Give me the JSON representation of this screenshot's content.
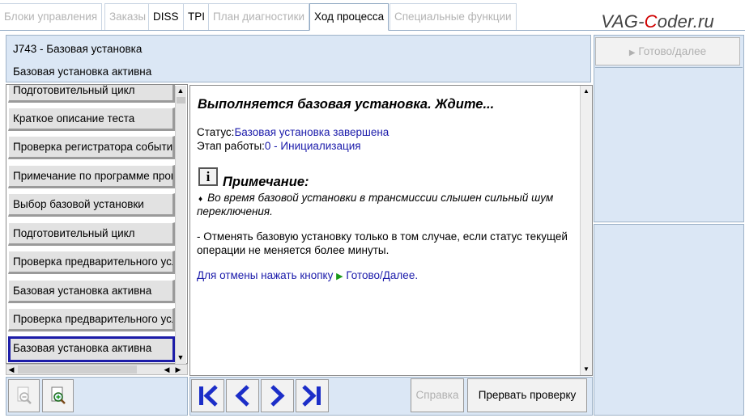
{
  "tabs": [
    {
      "label": "Блоки управления",
      "enabled": false
    },
    {
      "label": "Заказы",
      "enabled": false
    },
    {
      "label": "DISS",
      "enabled": true
    },
    {
      "label": "TPI",
      "enabled": true
    },
    {
      "label": "План диагностики",
      "enabled": false
    },
    {
      "label": "Ход процесса",
      "enabled": true,
      "active": true
    },
    {
      "label": "Специальные функции",
      "enabled": false
    }
  ],
  "watermark": {
    "part1": "VAG-",
    "part2": "C",
    "part3": "oder.ru"
  },
  "header": {
    "line1": "J743 - Базовая установка",
    "line2": "Базовая установка активна"
  },
  "steps": [
    "Подготовительный цикл",
    "Краткое описание теста",
    "Проверка регистратора событий",
    "Примечание по программе проверки",
    "Выбор базовой установки",
    "Подготовительный цикл",
    "Проверка предварительного условия",
    "Базовая установка активна",
    "Проверка предварительного условия",
    "Базовая установка активна"
  ],
  "content": {
    "heading": "Выполняется базовая установка. Ждите...",
    "status_label": "Статус:",
    "status_value": "Базовая установка завершена",
    "stage_label": "Этап работы:",
    "stage_value": "0 - Инициализация",
    "info_icon_glyph": "i",
    "note_title": "Примечание:",
    "bullet": "♦",
    "note_line1": "Во время базовой установки в трансмиссии слышен сильный шум",
    "note_line2": "переключения.",
    "cancel_line1": "- Отменять базовую установку только в том случае, если статус текущей",
    "cancel_line2": "операции не меняется более минуты.",
    "hint_prefix": "Для отмены нажать кнопку",
    "hint_suffix": "Готово/Далее."
  },
  "right_panel": {
    "go_button": "Готово/далее"
  },
  "buttons": {
    "help": "Справка",
    "abort": "Прервать проверку"
  },
  "colors": {
    "accent_blue": "#1a1aaa",
    "nav_blue": "#1c2ec8",
    "green_arrow": "#1a9a1a",
    "panel_bg": "#dbe7f5"
  }
}
